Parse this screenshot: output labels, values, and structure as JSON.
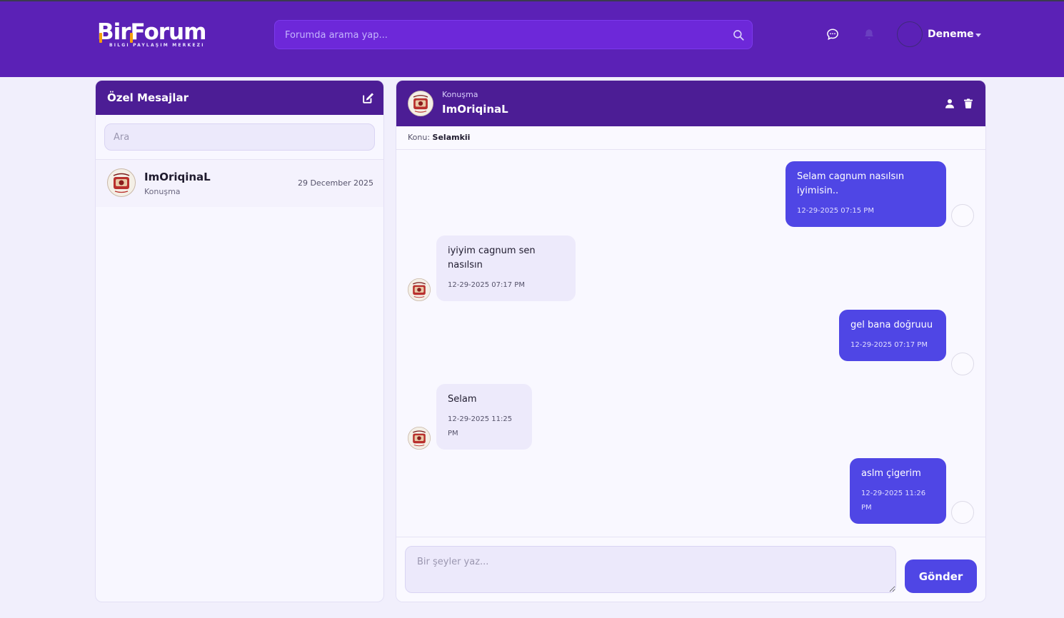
{
  "header": {
    "logo_text": "BirForum",
    "logo_tagline": "BILGI PAYLAŞIM MERKEZI",
    "search_placeholder": "Forumda arama yap...",
    "username": "Deneme",
    "icons": [
      "chat-icon",
      "bell-icon",
      "search-icon",
      "caret-down-icon"
    ]
  },
  "sidebar": {
    "title": "Özel Mesajlar",
    "search_placeholder": "Ara",
    "conversations": [
      {
        "name": "ImOriqinaL",
        "subtitle": "Konuşma",
        "date": "29 December 2025"
      }
    ]
  },
  "chat": {
    "header_sub": "Konuşma",
    "header_name": "ImOriqinaL",
    "topic_label": "Konu:",
    "topic_value": "Selamkii",
    "messages": [
      {
        "direction": "out",
        "text": "Selam cagnum nasılsın iyimisin..",
        "time": "12-29-2025 07:15 PM"
      },
      {
        "direction": "in",
        "text": "iyiyim cagnum sen nasılsın",
        "time": "12-29-2025 07:17 PM"
      },
      {
        "direction": "out",
        "text": "gel bana doğruuu",
        "time": "12-29-2025 07:17 PM"
      },
      {
        "direction": "in",
        "text": "Selam",
        "time": "12-29-2025 11:25 PM"
      },
      {
        "direction": "out",
        "text": "aslm çigerim",
        "time": "12-29-2025 11:26 PM"
      }
    ],
    "composer_placeholder": "Bir şeyler yaz...",
    "send_label": "Gönder"
  },
  "colors": {
    "header_bg": "#5b21b6",
    "panel_header_bg": "#4c1d95",
    "accent": "#4f46e5",
    "logo_accent": "#f59e0b",
    "page_bg": "#f1effc"
  }
}
